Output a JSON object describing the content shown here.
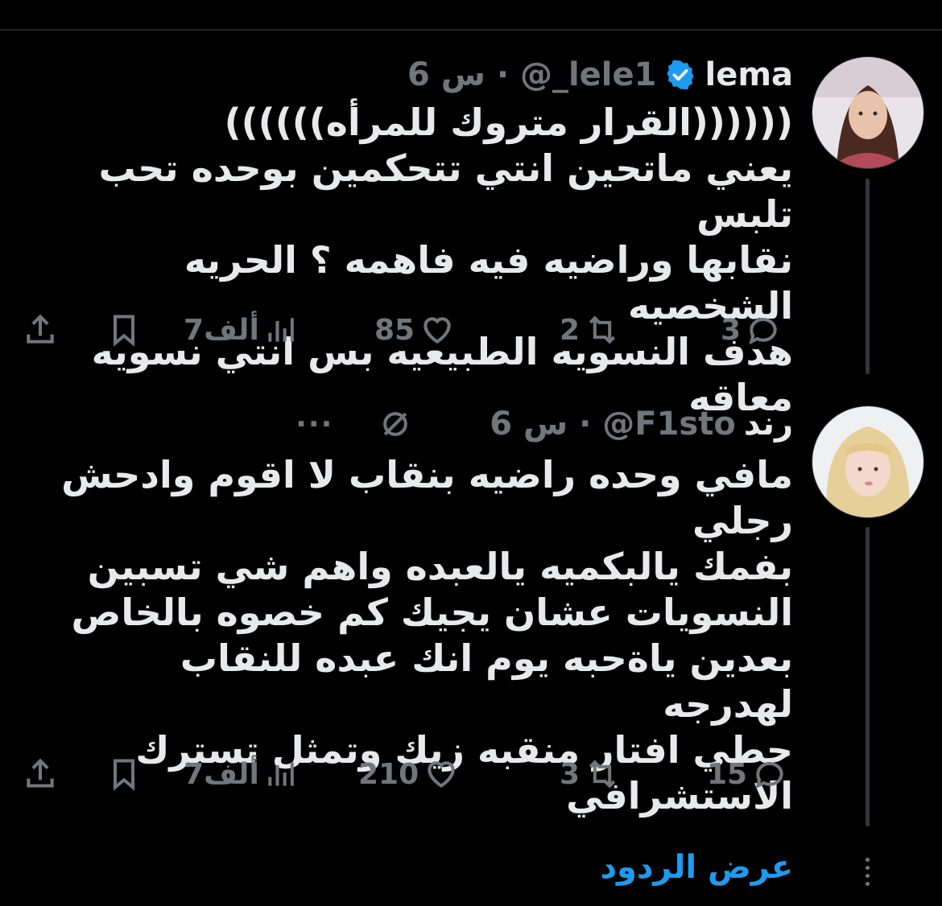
{
  "colors": {
    "background": "#000000",
    "text": "#e7e9ea",
    "muted": "#71767b",
    "accent": "#1d9bf0"
  },
  "tweets": [
    {
      "display_name": "lema",
      "handle": "@_lele1",
      "time": "6 س",
      "verified": true,
      "text": "((((((القرار متروك للمرأه))))))\nيعني ماتحين انتي تتحكمين بوحده تحب تلبس\nنقابها وراضيه فيه فاهمه ؟ الحريه الشخصيه\nهدف النسويه الطبيعيه بس انتي نسويه معاقه",
      "replies": "3",
      "retweets": "2",
      "likes": "85",
      "views": "7ألف",
      "icons": [
        "reply-icon",
        "retweet-icon",
        "like-icon",
        "views-icon",
        "bookmark-icon",
        "share-icon"
      ]
    },
    {
      "display_name": "رند",
      "handle": "@F1sto",
      "time": "6 س",
      "verified": false,
      "text": "مافي وحده راضيه بنقاب لا اقوم وادحش رجلي\nبفمك يالبكميه يالعبده واهم شي تسبين\nالنسويات عشان يجيك كم خصوه بالخاص\nبعدين ياةحبه يوم انك عبده للنقاب لهدرجه\nحطي افتار منقبه زيك وتمثل تسترك\nالاستشرافي",
      "replies": "15",
      "retweets": "3",
      "likes": "210",
      "views": "7ألف",
      "more_label": "···",
      "icons": [
        "grok-icon",
        "more-icon",
        "reply-icon",
        "retweet-icon",
        "like-icon",
        "views-icon",
        "bookmark-icon",
        "share-icon"
      ]
    }
  ],
  "footer": {
    "show_replies_label": "عرض الردود"
  }
}
